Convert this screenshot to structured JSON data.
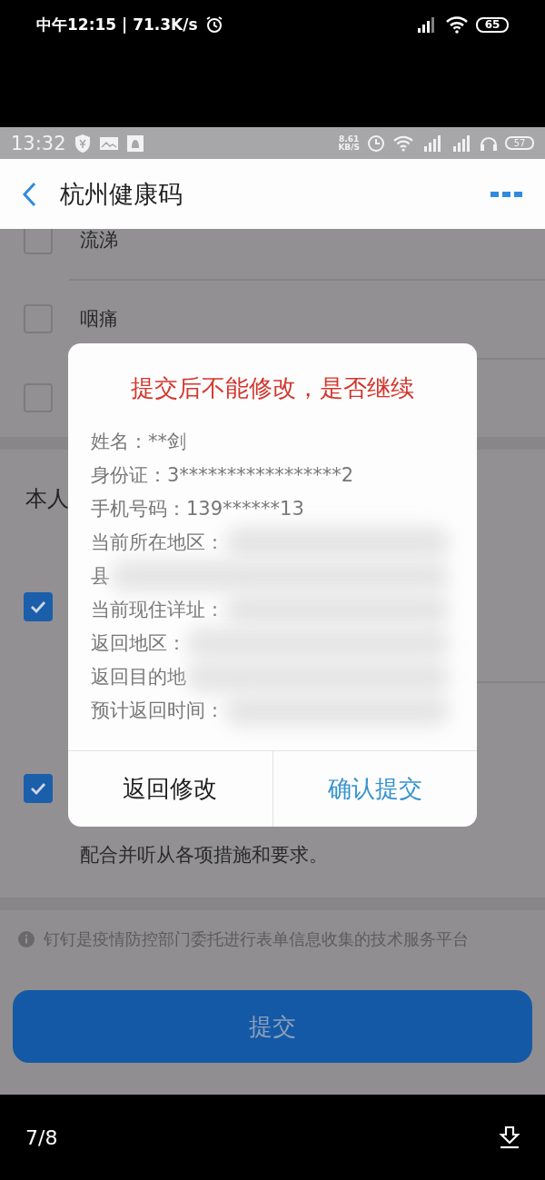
{
  "viewer_status_bar": {
    "time_speed": "中午12:15 | 71.3K/s",
    "battery": "65"
  },
  "phone_status_bar": {
    "time": "13:32",
    "net_speed": "8.61",
    "net_unit": "KB/S",
    "battery": "57"
  },
  "header": {
    "title": "杭州健康码"
  },
  "symptoms": [
    {
      "label": "流涕",
      "checked": false
    },
    {
      "label": "咽痛",
      "checked": false
    },
    {
      "checked": false
    }
  ],
  "commitment": {
    "heading": "本人",
    "items": [
      {
        "checked": true
      },
      {
        "checked": true,
        "text": "配合并听从各项措施和要求。"
      }
    ]
  },
  "notice": "钉钉是疫情防控部门委托进行表单信息收集的技术服务平台",
  "submit_button": {
    "label": "提交"
  },
  "dialog": {
    "title": "提交后不能修改，是否继续",
    "lines": [
      {
        "text": "姓名：**剑",
        "redacted": false
      },
      {
        "text": "身份证：3*****************2",
        "redacted": false
      },
      {
        "text": "手机号码：139******13",
        "redacted": false
      },
      {
        "text": "当前所在地区：",
        "redacted": true
      },
      {
        "text": "县",
        "redacted": true
      },
      {
        "text": "当前现住详址：",
        "redacted": true
      },
      {
        "text": "返回地区：",
        "redacted": true
      },
      {
        "text": "返回目的地",
        "redacted": true
      },
      {
        "text": "预计返回时间：",
        "redacted": true
      }
    ],
    "buttons": [
      {
        "label": "返回修改",
        "kind": "cancel"
      },
      {
        "label": "确认提交",
        "kind": "confirm"
      }
    ]
  },
  "viewer_bottom_bar": {
    "page_counter": "7/8"
  }
}
